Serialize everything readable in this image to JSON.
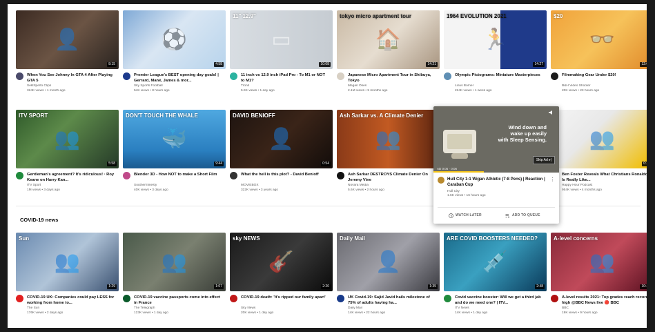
{
  "colors": {
    "background": "#ffffff",
    "text": "#0f0f0f",
    "secondary_text": "#606060",
    "overlay": "#1a1a1a"
  },
  "row1": [
    {
      "title": "When You See Johnny In GTA 4 After Playing GTA 5",
      "channel": "Sektrtpe/to Clips",
      "stats": "324K views • 1 month ago",
      "duration": "8:15",
      "thumb_bg": "linear-gradient(135deg,#3b2a22,#6b5444 50%,#2a2420)",
      "avatar": "#4a4a6a",
      "glyph": "👤"
    },
    {
      "title": "Premier League's BEST opening day goals! | Gerrard, Mané, James & mor...",
      "channel": "Sky Sports Football",
      "stats": "54K views • 8 hours ago",
      "duration": "4:58",
      "thumb_bg": "linear-gradient(135deg,#7fa9d6,#d9e6f3 45%,#b8d4ec)",
      "avatar": "#1c3a8c",
      "glyph": "⚽"
    },
    {
      "title": "11 inch vs 12.9 inch iPad Pro - To M1 or NOT to M1?",
      "channel": "Tronit",
      "stats": "5.9K views • 1 day ago",
      "duration": "10:08",
      "thumb_bg": "linear-gradient(90deg,#d8dde2,#c6ccd2)",
      "avatar": "#2bb3a0",
      "glyph": "▭"
    },
    {
      "title": "Japanese Micro Apartment Tour in Shibuya, Tokyo",
      "channel": "Megan Okes",
      "stats": "2.1M views • 5 months ago",
      "duration": "14:21",
      "thumb_bg": "linear-gradient(135deg,#c9b9a4,#e6ddd0 50%,#a89580)",
      "avatar": "#d8d0c4",
      "glyph": "🏠"
    },
    {
      "title": "Olympic Pictograms: Miniature Masterpieces",
      "channel": "Linus Borner",
      "stats": "224K views • 1 week ago",
      "duration": "14:27",
      "thumb_bg": "linear-gradient(90deg,#f4f4f4 55%,#1f3a8a 55%)",
      "avatar": "#5f8fb4",
      "glyph": "🏃"
    },
    {
      "title": "Filmmaking Gear Under $20!",
      "channel": "B&H Video Shooter",
      "stats": "20K views • 23 hours ago",
      "duration": "12:07",
      "thumb_bg": "linear-gradient(135deg,#f0a23a,#f6c25a 50%,#e08a2a)",
      "avatar": "#1b1b1b",
      "glyph": "👓"
    }
  ],
  "row1_overlays": [
    {
      "text": "",
      "color": "#fff"
    },
    {
      "text": "",
      "color": "#fff"
    },
    {
      "text": "11\"   12.9\"",
      "color": "#fff"
    },
    {
      "text": "tokyo micro apartment tour",
      "color": "#222"
    },
    {
      "text": "1964   EVOLUTION   2021",
      "color": "#111"
    },
    {
      "text": "$20",
      "color": "#fff"
    }
  ],
  "row2": [
    {
      "title": "Gentleman's agreement? It's ridiculous! · Roy Keane on Harry Kan...",
      "channel": "ITV Sport",
      "stats": "1M views • 3 days ago",
      "duration": "5:58",
      "thumb_bg": "linear-gradient(135deg,#2f5a2a,#5d8a4a 40%,#253a28)",
      "avatar": "#1f8a3c",
      "glyph": "👥",
      "overlay": "ITV SPORT"
    },
    {
      "title": "Blender 3D - How NOT to make a Short Film",
      "channel": "Southernfinesty",
      "stats": "40K views • 3 days ago",
      "duration": "9:44",
      "thumb_bg": "linear-gradient(180deg,#4fa8e0,#2a7fc0 70%,#1a5a90)",
      "avatar": "#c04a8a",
      "glyph": "🐳",
      "overlay": "DON'T TOUCH THE WHALE"
    },
    {
      "title": "What the hell is this plot? - David Benioff",
      "channel": "MOVIEBOX",
      "stats": "322K views • 3 years ago",
      "duration": "0:54",
      "thumb_bg": "linear-gradient(135deg,#1e1410,#3a2418 50%,#120c0a)",
      "avatar": "#333333",
      "glyph": "👤",
      "overlay": "DAVID BENIOFF"
    },
    {
      "title": "Ash Sarkar DESTROYS Climate Denier On Jeremy Vine",
      "channel": "Novara Media",
      "stats": "5.6K views • 2 hours ago",
      "duration": "",
      "thumb_bg": "linear-gradient(90deg,#8a3a18,#c25a22 50%,#5a2410)",
      "avatar": "#111111",
      "glyph": "👥",
      "overlay": "Ash Sarkar vs. A Climate Denier"
    },
    {
      "title": "Hull City 1-1 Wigan Athletic (7-8 Pens) | Reaction | Caraban Cup",
      "channel": "Hull City",
      "stats": "1.6K views • 16 hours ago",
      "duration": "",
      "thumb_bg": "#6b6a62",
      "avatar": "#b98a2e",
      "glyph": "",
      "overlay": ""
    },
    {
      "title": "Ben Foster Reveals What Christians Ronaldo Is Really Like...",
      "channel": "Happy Hour Podcast",
      "stats": "954K views • 4 months ago",
      "duration": "0:21",
      "thumb_bg": "linear-gradient(135deg,#f4f4f4,#e8e8e8 40%,#f0c21a 90%)",
      "avatar": "#e8c020",
      "glyph": "👥",
      "overlay": ""
    }
  ],
  "covid": {
    "heading": "COVID-19 news",
    "close_label": "×",
    "items": [
      {
        "title": "COVID-19 UK: Companies could pay LESS for working from home to...",
        "channel": "The Sun",
        "stats": "176K views • 2 days ago",
        "duration": "1:29",
        "thumb_bg": "linear-gradient(135deg,#6a8ab0,#b0c4d8 50%,#3a5070)",
        "avatar": "#e22020",
        "glyph": "👥",
        "overlay": "Sun"
      },
      {
        "title": "COVID-19 vaccine passports come into effect in France",
        "channel": "The Telegraph",
        "stats": "123K views • 1 day ago",
        "duration": "1:07",
        "thumb_bg": "linear-gradient(135deg,#4a5a4a,#7a8070 50%,#3a3e38)",
        "avatar": "#0a5a2a",
        "glyph": "👥",
        "overlay": ""
      },
      {
        "title": "COVID-19 death: 'It's ripped our family apart'",
        "channel": "Sky News",
        "stats": "20K views • 1 day ago",
        "duration": "2:20",
        "thumb_bg": "linear-gradient(135deg,#1a1a1a,#3a3a3a 50%,#0a0a0a)",
        "avatar": "#c01818",
        "glyph": "🎸",
        "overlay": "sky NEWS"
      },
      {
        "title": "UK Covid-19: Sajid Javid hails milestone of 75% of adults having ha...",
        "channel": "Daily Mail",
        "stats": "14K views • 22 hours ago",
        "duration": "1:35",
        "thumb_bg": "linear-gradient(135deg,#6a6a70,#a0a0a8 50%,#3a3a40)",
        "avatar": "#183a8a",
        "glyph": "👤",
        "overlay": "Daily Mail"
      },
      {
        "title": "Covid vaccine booster: Will we get a third jab and do we need one? | ITV...",
        "channel": "ITV News",
        "stats": "14K views • 1 day ago",
        "duration": "2:48",
        "thumb_bg": "linear-gradient(135deg,#1a6a8a,#3aa0c0 45%,#0a3a5a)",
        "avatar": "#1f8a3c",
        "glyph": "💉",
        "overlay": "ARE COVID BOOSTERS NEEDED?"
      },
      {
        "title": "A-level results 2021: Top grades reach record high @BBC News live 🔴 BBC",
        "channel": "BBC",
        "stats": "19K views • 9 hours ago",
        "duration": "10:42",
        "thumb_bg": "linear-gradient(135deg,#8a2a3a,#c04a5a 50%,#5a1020)",
        "avatar": "#b01010",
        "glyph": "👥",
        "overlay": "A-level concerns"
      }
    ]
  },
  "hover_card": {
    "ad_line1": "Wind down and",
    "ad_line2": "wake up easily",
    "ad_line3": "with Sleep Sensing.",
    "ad_tag": "AD 0:05 · 0:06",
    "skip_label": "Skip Ad ▸|",
    "title": "Hull City 1-1 Wigan Athletic (7-8 Pens) | Reaction | Caraban Cup",
    "channel": "Hull City",
    "stats": "1.6K views • 16 hours ago",
    "watch_later": "WATCH LATER",
    "add_to_queue": "ADD TO QUEUE",
    "more": "⋮"
  }
}
